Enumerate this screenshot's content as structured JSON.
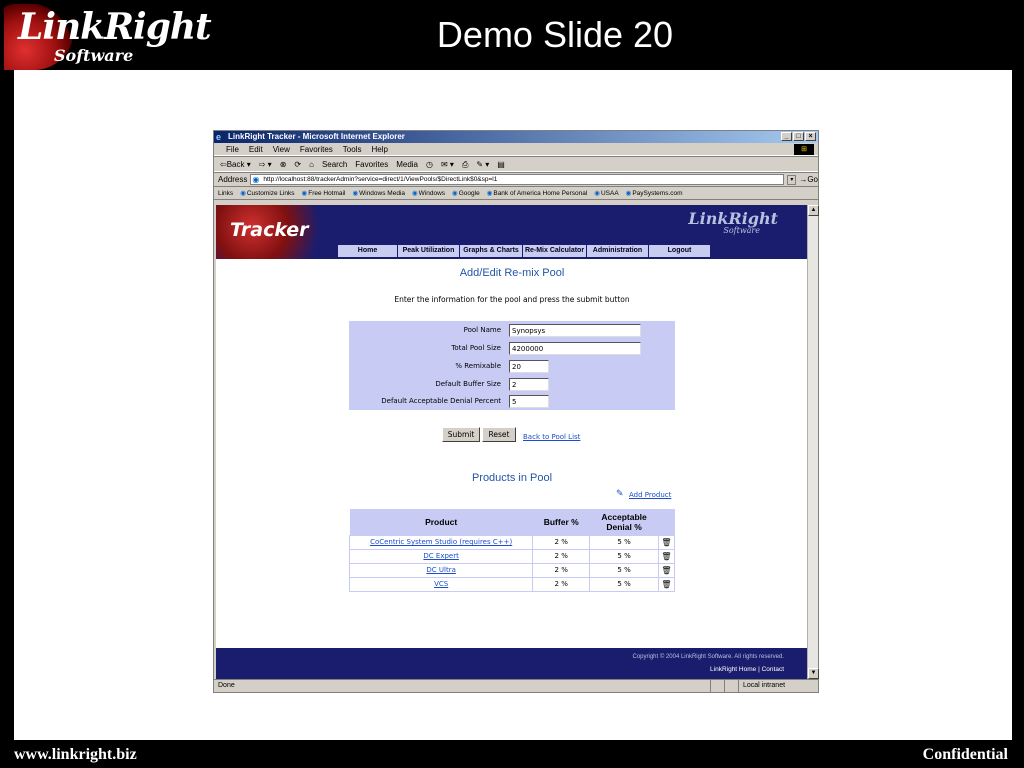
{
  "slide": {
    "logo_main": "LinkRight",
    "logo_sub": "Software",
    "title": "Demo Slide 20",
    "footer_left": "www.linkright.biz",
    "footer_right": "Confidential"
  },
  "browser": {
    "window_title": "LinkRight Tracker - Microsoft Internet Explorer",
    "menu": [
      "File",
      "Edit",
      "View",
      "Favorites",
      "Tools",
      "Help"
    ],
    "toolbar": [
      "⇦Back ▾",
      "⇨ ▾",
      "⊗",
      "⟳",
      "⌂",
      "Search",
      "Favorites",
      "Media",
      "◷",
      "✉ ▾",
      "⎙",
      "✎ ▾",
      "▤"
    ],
    "address_label": "Address",
    "address_value": "http://localhost:88/trackerAdmin?service=direct/1/ViewPools/$DirectLink$0&sp=l1",
    "go_label": "Go",
    "links_label": "Links",
    "links": [
      "Customize Links",
      "Free Hotmail",
      "Windows Media",
      "Windows",
      "Google",
      "Bank of America Home Personal",
      "USAA",
      "PaySystems.com"
    ],
    "status_text": "Done",
    "status_zone": "Local intranet"
  },
  "app": {
    "header_word": "Tracker",
    "brand": "LinkRight",
    "brand_sub": "Software",
    "nav": [
      "Home",
      "Peak Utilization",
      "Graphs & Charts",
      "Re-Mix Calculator",
      "Administration",
      "Logout"
    ],
    "page_heading": "Add/Edit Re-mix Pool",
    "instructions": "Enter the information for the pool and press the submit button",
    "form": {
      "pool_name_label": "Pool Name",
      "pool_name_value": "Synopsys",
      "total_size_label": "Total Pool Size",
      "total_size_value": "4200000",
      "remixable_label": "% Remixable",
      "remixable_value": "20",
      "buffer_label": "Default Buffer Size",
      "buffer_value": "2",
      "denial_label": "Default Acceptable Denial Percent",
      "denial_value": "5"
    },
    "submit_label": "Submit",
    "reset_label": "Reset",
    "back_link": "Back to Pool List",
    "products_heading": "Products in Pool",
    "add_product": "Add Product",
    "table": {
      "headers": [
        "Product",
        "Buffer %",
        "Acceptable Denial %"
      ],
      "rows": [
        {
          "product": "CoCentric System Studio (requires C++)",
          "buffer": "2 %",
          "denial": "5 %"
        },
        {
          "product": "DC Expert",
          "buffer": "2 %",
          "denial": "5 %"
        },
        {
          "product": "DC Ultra",
          "buffer": "2 %",
          "denial": "5 %"
        },
        {
          "product": "VCS",
          "buffer": "2 %",
          "denial": "5 %"
        }
      ]
    },
    "copyright": "Copyright © 2004 LinkRight Software. All rights reserved.",
    "footer_home": "LinkRight Home",
    "footer_sep": "|",
    "footer_contact": "Contact"
  }
}
